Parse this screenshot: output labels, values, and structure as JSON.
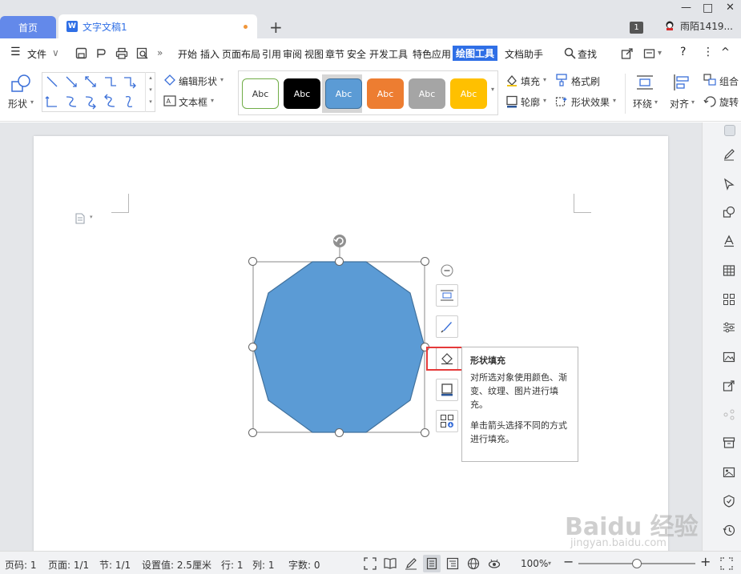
{
  "tabs": {
    "home": "首页",
    "doc_name": "文字文稿1",
    "new_tab": "+"
  },
  "window": {
    "badge": "1",
    "user": "雨陌1419...",
    "minimize": "—",
    "maximize": "□",
    "close": "✕"
  },
  "menu": {
    "file": "文件",
    "items": [
      "开始",
      "插入",
      "页面布局",
      "引用",
      "审阅",
      "视图",
      "章节",
      "安全",
      "开发工具",
      "特色应用",
      "绘图工具",
      "文档助手"
    ],
    "active": "绘图工具",
    "search": "查找",
    "more": "»",
    "help": "?",
    "overflow": "⋮",
    "collapse": "^"
  },
  "ribbon": {
    "shape": "形状",
    "edit_shape": "编辑形状",
    "text_box": "文本框",
    "presets": [
      "Abc",
      "Abc",
      "Abc",
      "Abc",
      "Abc",
      "Abc"
    ],
    "fill": "填充",
    "format_brush": "格式刷",
    "outline": "轮廓",
    "shape_effect": "形状效果",
    "wrap": "环绕",
    "align": "对齐",
    "group": "组合",
    "rotate": "旋转"
  },
  "tooltip": {
    "title": "形状填充",
    "line1": "对所选对象使用颜色、渐变、纹理、图片进行填充。",
    "line2": "单击箭头选择不同的方式进行填充。"
  },
  "status": {
    "page_num": "页码: 1",
    "pages": "页面: 1/1",
    "section": "节: 1/1",
    "setting": "设置值: 2.5厘米",
    "row": "行: 1",
    "col": "列: 1",
    "words": "字数: 0",
    "zoom": "100%",
    "zoom_level": 1.0
  },
  "watermark": {
    "line1": "Baidu 经验",
    "line2": "jingyan.baidu.com"
  },
  "colors": {
    "accent": "#2f6fe6",
    "home_tab": "#6389ea",
    "shape_fill": "#5b9bd5",
    "shape_stroke": "#41719c",
    "highlight": "#e53a3a",
    "preset_colors": [
      "#ffffff",
      "#000000",
      "#5b9bd5",
      "#ed7d31",
      "#a5a5a5",
      "#ffc000"
    ]
  }
}
